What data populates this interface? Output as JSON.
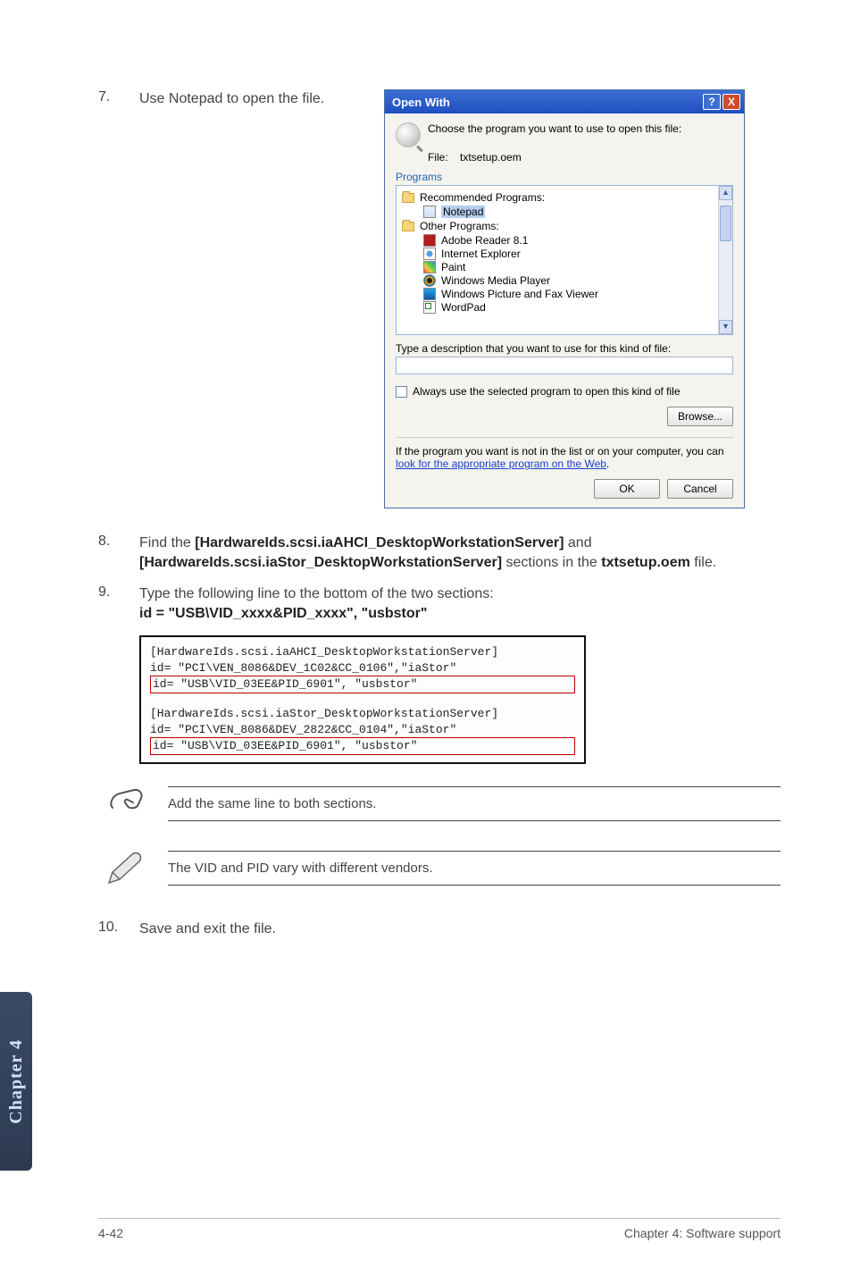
{
  "steps": {
    "s7": {
      "num": "7.",
      "text": "Use Notepad to open the file."
    },
    "s8": {
      "num": "8.",
      "prefix": "Find the ",
      "b1": "[HardwareIds.scsi.iaAHCI_DesktopWorkstationServer]",
      "mid": " and ",
      "b2": "[HardwareIds.scsi.iaStor_DesktopWorkstationServer]",
      "mid2": " sections in the ",
      "b3": "txtsetup.oem",
      "suffix": " file."
    },
    "s9": {
      "num": "9.",
      "line1": "Type the following line to the bottom of the two sections:",
      "line2": "id = \"USB\\VID_xxxx&PID_xxxx\", \"usbstor\""
    },
    "s10": {
      "num": "10.",
      "text": "Save and exit the file."
    }
  },
  "dialog": {
    "title": "Open With",
    "choose": "Choose the program you want to use to open this file:",
    "file_label": "File:",
    "file_name": "txtsetup.oem",
    "tab": "Programs",
    "group_rec": "Recommended Programs:",
    "group_other": "Other Programs:",
    "items": {
      "notepad": "Notepad",
      "adobe": "Adobe Reader 8.1",
      "ie": "Internet Explorer",
      "paint": "Paint",
      "wmp": "Windows Media Player",
      "fax": "Windows Picture and Fax Viewer",
      "wordpad": "WordPad"
    },
    "desc_label": "Type a description that you want to use for this kind of file:",
    "always": "Always use the selected program to open this kind of file",
    "browse": "Browse...",
    "look_prefix": "If the program you want is not in the list or on your computer, you can ",
    "look_link": "look for the appropriate program on the Web",
    "look_suffix": ".",
    "ok": "OK",
    "cancel": "Cancel"
  },
  "code": {
    "l1": "[HardwareIds.scsi.iaAHCI_DesktopWorkstationServer]",
    "l2": "id= \"PCI\\VEN_8086&DEV_1C02&CC_0106\",\"iaStor\"",
    "l3": "id= \"USB\\VID_03EE&PID_6901\", \"usbstor\"",
    "l4": "[HardwareIds.scsi.iaStor_DesktopWorkstationServer]",
    "l5": "id= \"PCI\\VEN_8086&DEV_2822&CC_0104\",\"iaStor\"",
    "l6": "id= \"USB\\VID_03EE&PID_6901\", \"usbstor\""
  },
  "notes": {
    "n1": "Add the same line to both sections.",
    "n2": "The VID and PID vary with different vendors."
  },
  "side_tab": "Chapter 4",
  "footer": {
    "left": "4-42",
    "right": "Chapter 4: Software support"
  }
}
